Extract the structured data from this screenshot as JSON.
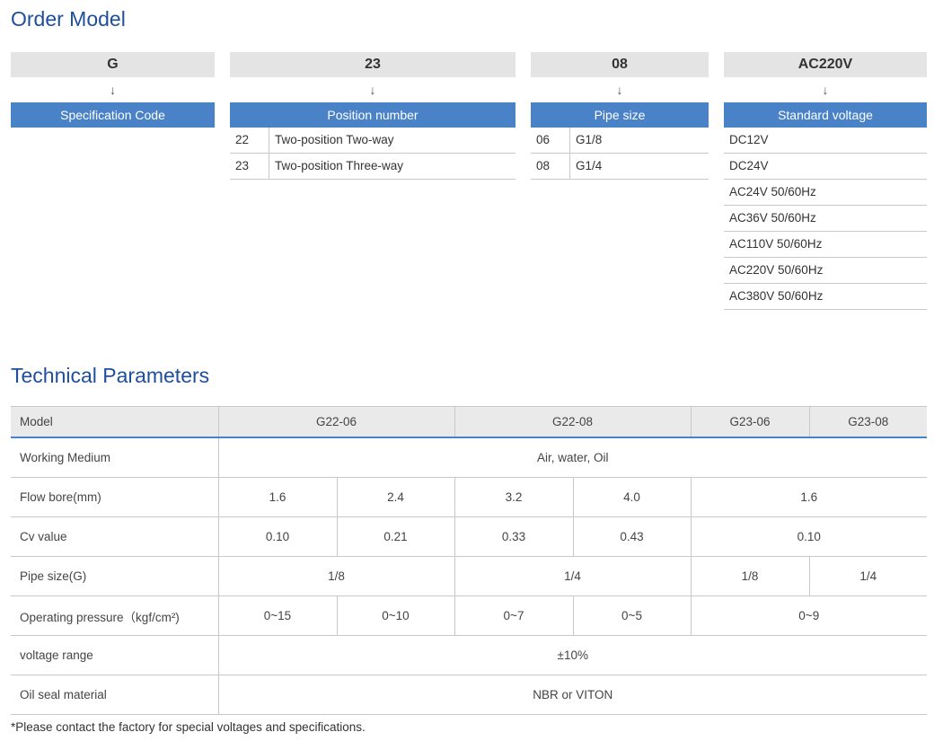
{
  "order_model": {
    "title": "Order Model",
    "columns": [
      {
        "code": "G",
        "arrow": "↓",
        "header": "Specification  Code",
        "rows": []
      },
      {
        "code": "23",
        "arrow": "↓",
        "header": "Position number",
        "rows": [
          {
            "k": "22",
            "v": "Two-position Two-way"
          },
          {
            "k": "23",
            "v": "Two-position Three-way"
          }
        ]
      },
      {
        "code": "08",
        "arrow": "↓",
        "header": "Pipe size",
        "rows": [
          {
            "k": "06",
            "v": "G1/8"
          },
          {
            "k": "08",
            "v": "G1/4"
          }
        ]
      },
      {
        "code": "AC220V",
        "arrow": "↓",
        "header": "Standard voltage",
        "rows": [
          "DC12V",
          "DC24V",
          "AC24V 50/60Hz",
          "AC36V 50/60Hz",
          "AC110V 50/60Hz",
          "AC220V 50/60Hz",
          "AC380V 50/60Hz"
        ]
      }
    ]
  },
  "tech": {
    "title": "Technical Parameters",
    "header": {
      "label": "Model",
      "m1": "G22-06",
      "m2": "G22-08",
      "m3": "G23-06",
      "m4": "G23-08"
    },
    "working_medium": {
      "label": "Working Medium",
      "value": "Air, water, Oil"
    },
    "flow_bore": {
      "label": "Flow bore(mm)",
      "a": "1.6",
      "b": "2.4",
      "c": "3.2",
      "d": "4.0",
      "e": "1.6"
    },
    "cv": {
      "label": "Cv value",
      "a": "0.10",
      "b": "0.21",
      "c": "0.33",
      "d": "0.43",
      "e": "0.10"
    },
    "pipe": {
      "label": "Pipe size(G)",
      "a": "1/8",
      "b": "1/4",
      "c": "1/8",
      "d": "1/4"
    },
    "pressure": {
      "label": "Operating pressure（kgf/cm²)",
      "a": "0~15",
      "b": "0~10",
      "c": "0~7",
      "d": "0~5",
      "e": "0~9"
    },
    "voltage": {
      "label": "voltage range",
      "value": "±10%"
    },
    "seal": {
      "label": "Oil seal material",
      "value": "NBR or VITON"
    }
  },
  "note": "*Please contact the factory for special voltages and specifications."
}
